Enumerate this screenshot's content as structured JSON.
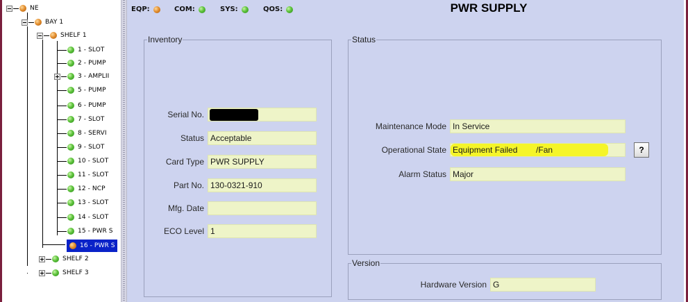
{
  "tree": {
    "nodes": [
      {
        "label": "NE",
        "status": "orange"
      },
      {
        "label": "BAY 1",
        "status": "orange"
      },
      {
        "label": "SHELF 1",
        "status": "orange"
      },
      {
        "label": "1 - SLOT",
        "status": "green"
      },
      {
        "label": "2 - PUMP",
        "status": "green"
      },
      {
        "label": "3 - AMPLII",
        "status": "green"
      },
      {
        "label": "5 - PUMP",
        "status": "green"
      },
      {
        "label": "6 - PUMP",
        "status": "green"
      },
      {
        "label": "7 - SLOT",
        "status": "green"
      },
      {
        "label": "8 - SERVI",
        "status": "green"
      },
      {
        "label": "9 - SLOT",
        "status": "green"
      },
      {
        "label": "10 - SLOT",
        "status": "green"
      },
      {
        "label": "11 - SLOT",
        "status": "green"
      },
      {
        "label": "12 - NCP",
        "status": "green"
      },
      {
        "label": "13 - SLOT",
        "status": "green"
      },
      {
        "label": "14 - SLOT",
        "status": "green"
      },
      {
        "label": "15 - PWR S",
        "status": "green"
      },
      {
        "label": "16 - PWR S",
        "status": "orange",
        "selected": true
      },
      {
        "label": "SHELF 2",
        "status": "green"
      },
      {
        "label": "SHELF 3",
        "status": "green"
      }
    ]
  },
  "statusbar": {
    "eqp_label": "EQP:",
    "eqp_status": "orange",
    "com_label": "COM:",
    "com_status": "green",
    "sys_label": "SYS:",
    "sys_status": "green",
    "qos_label": "QOS:",
    "qos_status": "green"
  },
  "title": "PWR SUPPLY",
  "inventory": {
    "legend": "Inventory",
    "serial_label": "Serial No.",
    "serial_value": "",
    "status_label": "Status",
    "status_value": "Acceptable",
    "card_type_label": "Card Type",
    "card_type_value": "PWR SUPPLY",
    "part_no_label": "Part No.",
    "part_no_value": "130-0321-910",
    "mfg_date_label": "Mfg. Date",
    "mfg_date_value": "",
    "eco_level_label": "ECO Level",
    "eco_level_value": "1"
  },
  "status": {
    "legend": "Status",
    "maintenance_label": "Maintenance Mode",
    "maintenance_value": "In Service",
    "operational_label": "Operational State",
    "operational_value": "Equipment Failed        /Fan",
    "alarm_label": "Alarm Status",
    "alarm_value": "Major",
    "help_label": "?"
  },
  "version": {
    "legend": "Version",
    "hardware_label": "Hardware Version",
    "hardware_value": "G"
  },
  "colors": {
    "green_led": "#5cc23a",
    "orange_led": "#e08a2a",
    "selection": "#0a22c8",
    "field_bg": "#eef4c8",
    "highlight": "#f5f529",
    "panel_bg": "#cdd3ef"
  }
}
